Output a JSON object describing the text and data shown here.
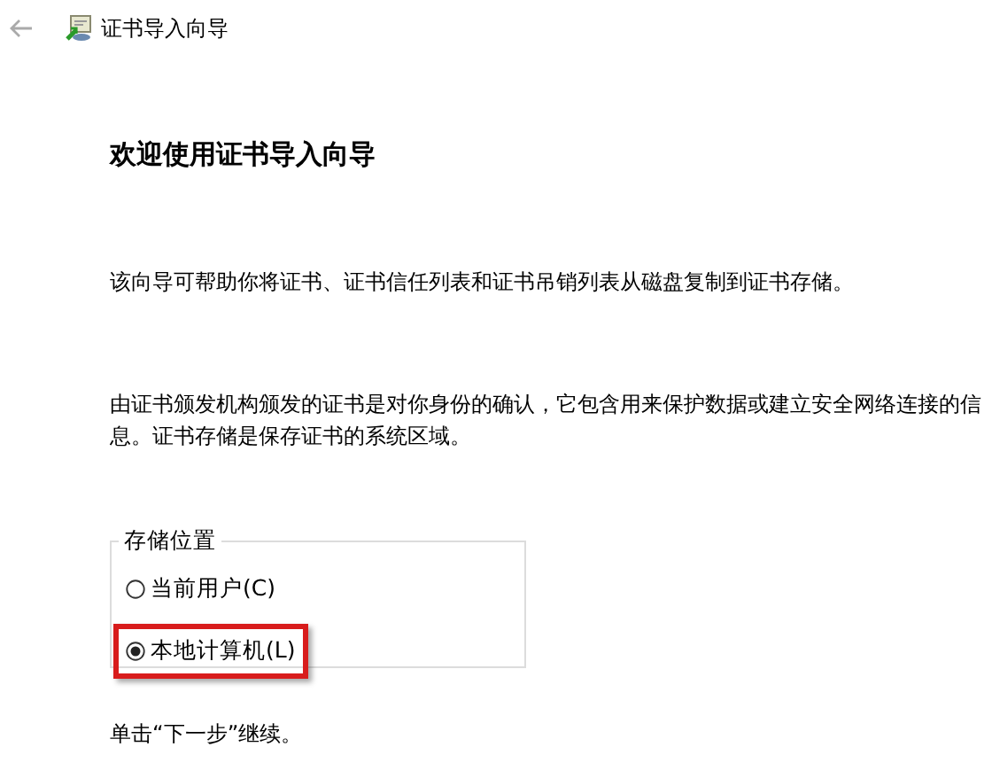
{
  "window": {
    "title": "证书导入向导"
  },
  "heading": "欢迎使用证书导入向导",
  "paragraphs": [
    "该向导可帮助你将证书、证书信任列表和证书吊销列表从磁盘复制到证书存储。",
    "由证书颁发机构颁发的证书是对你身份的确认，它包含用来保护数据或建立安全网络连接的信息。证书存储是保存证书的系统区域。"
  ],
  "store_location": {
    "label": "存储位置",
    "options": [
      {
        "label": "当前用户(C)",
        "selected": false,
        "highlighted": false
      },
      {
        "label": "本地计算机(L)",
        "selected": true,
        "highlighted": true
      }
    ]
  },
  "footer": "单击“下一步”继续。"
}
